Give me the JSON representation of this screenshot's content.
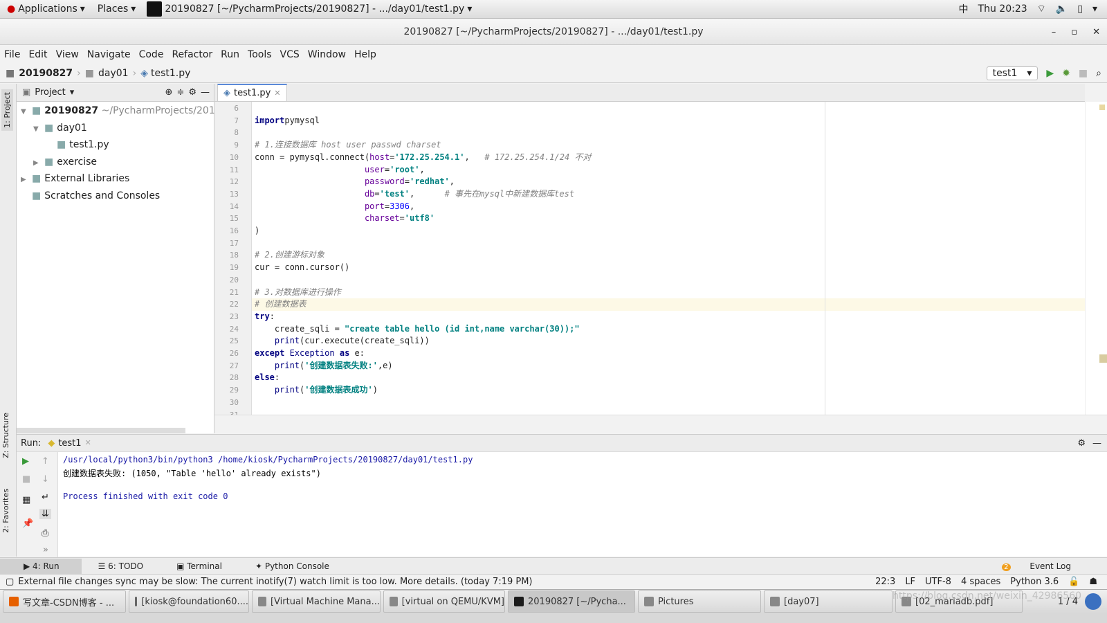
{
  "topbar": {
    "applications": "Applications",
    "places": "Places",
    "window_title": "20190827 [~/PycharmProjects/20190827] - .../day01/test1.py",
    "input_method": "中",
    "clock": "Thu 20:23"
  },
  "titlebar": {
    "title": "20190827 [~/PycharmProjects/20190827] - .../day01/test1.py"
  },
  "menu": [
    "File",
    "Edit",
    "View",
    "Navigate",
    "Code",
    "Refactor",
    "Run",
    "Tools",
    "VCS",
    "Window",
    "Help"
  ],
  "breadcrumb": [
    "20190827",
    "day01",
    "test1.py"
  ],
  "run_config": "test1",
  "side_tabs": {
    "project": "1: Project",
    "structure": "Z: Structure",
    "favorites": "2: Favorites"
  },
  "project": {
    "header": "Project",
    "tree": [
      {
        "label": "20190827",
        "extra": "~/PycharmProjects/2019",
        "level": 0,
        "arrow": "▼",
        "bold": true
      },
      {
        "label": "day01",
        "level": 1,
        "arrow": "▼"
      },
      {
        "label": "test1.py",
        "level": 2,
        "arrow": ""
      },
      {
        "label": "exercise",
        "level": 1,
        "arrow": "▶"
      },
      {
        "label": "External Libraries",
        "level": 0,
        "arrow": "▶"
      },
      {
        "label": "Scratches and Consoles",
        "level": 0,
        "arrow": ""
      }
    ]
  },
  "editor": {
    "tab": "test1.py",
    "cursor_line": 22,
    "lines": [
      {
        "n": "6",
        "t": []
      },
      {
        "n": "7",
        "t": [
          [
            "kw",
            "import"
          ],
          [
            "",
            "pymysql"
          ]
        ]
      },
      {
        "n": "8",
        "t": []
      },
      {
        "n": "9",
        "t": [
          [
            "cm",
            "# 1.连接数据库 host user passwd charset"
          ]
        ]
      },
      {
        "n": "10",
        "t": [
          [
            "",
            "conn = pymysql.connect("
          ],
          [
            "prm",
            "host"
          ],
          [
            "",
            "="
          ],
          [
            "str",
            "'172.25.254.1'"
          ],
          [
            "",
            ",   "
          ],
          [
            "cm",
            "# 172.25.254.1/24 不对"
          ]
        ]
      },
      {
        "n": "11",
        "t": [
          [
            "",
            "                      "
          ],
          [
            "prm",
            "user"
          ],
          [
            "",
            "="
          ],
          [
            "str",
            "'root'"
          ],
          [
            "",
            ","
          ]
        ]
      },
      {
        "n": "12",
        "t": [
          [
            "",
            "                      "
          ],
          [
            "prm",
            "password"
          ],
          [
            "",
            "="
          ],
          [
            "str",
            "'redhat'"
          ],
          [
            "",
            ","
          ]
        ]
      },
      {
        "n": "13",
        "t": [
          [
            "",
            "                      "
          ],
          [
            "prm",
            "db"
          ],
          [
            "",
            "="
          ],
          [
            "str",
            "'test'"
          ],
          [
            "",
            ",      "
          ],
          [
            "cm",
            "# 事先在mysql中新建数据库test"
          ]
        ]
      },
      {
        "n": "14",
        "t": [
          [
            "",
            "                      "
          ],
          [
            "prm",
            "port"
          ],
          [
            "",
            "="
          ],
          [
            "num",
            "3306"
          ],
          [
            "",
            ","
          ]
        ]
      },
      {
        "n": "15",
        "t": [
          [
            "",
            "                      "
          ],
          [
            "prm",
            "charset"
          ],
          [
            "",
            "="
          ],
          [
            "str",
            "'utf8'"
          ]
        ]
      },
      {
        "n": "16",
        "t": [
          [
            "",
            ")"
          ]
        ]
      },
      {
        "n": "17",
        "t": []
      },
      {
        "n": "18",
        "t": [
          [
            "cm",
            "# 2.创建游标对象"
          ]
        ]
      },
      {
        "n": "19",
        "t": [
          [
            "",
            "cur = conn.cursor()"
          ]
        ]
      },
      {
        "n": "20",
        "t": []
      },
      {
        "n": "21",
        "t": [
          [
            "cm",
            "# 3.对数据库进行操作"
          ]
        ]
      },
      {
        "n": "22",
        "t": [
          [
            "cm",
            "# 创建数据表"
          ]
        ]
      },
      {
        "n": "23",
        "t": [
          [
            "kw",
            "try"
          ],
          [
            "",
            ":"
          ]
        ]
      },
      {
        "n": "24",
        "t": [
          [
            "",
            "    create_sqli = "
          ],
          [
            "str",
            "\"create table hello (id int,name varchar(30));\""
          ]
        ]
      },
      {
        "n": "25",
        "t": [
          [
            "",
            "    "
          ],
          [
            "bi",
            "print"
          ],
          [
            "",
            "(cur.execute(create_sqli))"
          ]
        ]
      },
      {
        "n": "26",
        "t": [
          [
            "kw",
            "except"
          ],
          [
            "bi",
            " Exception "
          ],
          [
            "kw",
            "as"
          ],
          [
            "",
            " e:"
          ]
        ]
      },
      {
        "n": "27",
        "t": [
          [
            "",
            "    "
          ],
          [
            "bi",
            "print"
          ],
          [
            "",
            "("
          ],
          [
            "str",
            "'创建数据表失败:'"
          ],
          [
            "",
            ",e)"
          ]
        ]
      },
      {
        "n": "28",
        "t": [
          [
            "kw",
            "else"
          ],
          [
            "",
            ":"
          ]
        ]
      },
      {
        "n": "29",
        "t": [
          [
            "",
            "    "
          ],
          [
            "bi",
            "print"
          ],
          [
            "",
            "("
          ],
          [
            "str",
            "'创建数据表成功'"
          ],
          [
            "",
            ")"
          ]
        ]
      },
      {
        "n": "30",
        "t": []
      },
      {
        "n": "31",
        "t": []
      }
    ]
  },
  "run": {
    "label": "Run:",
    "tab": "test1",
    "output": [
      {
        "text": "/usr/local/python3/bin/python3 /home/kiosk/PycharmProjects/20190827/day01/test1.py",
        "color": "#1a1aa6"
      },
      {
        "text": "创建数据表失败: (1050, \"Table 'hello' already exists\")",
        "color": "#000000"
      },
      {
        "text": "",
        "color": "#000000"
      },
      {
        "text": "Process finished with exit code 0",
        "color": "#1a1aa6"
      }
    ]
  },
  "tool_tabs": [
    "4: Run",
    "6: TODO",
    "Terminal",
    "Python Console"
  ],
  "event_log": {
    "count": "2",
    "label": "Event Log"
  },
  "status": {
    "message": "External file changes sync may be slow: The current inotify(7) watch limit is too low. More details. (today 7:19 PM)",
    "position": "22:3",
    "line_sep": "LF",
    "encoding": "UTF-8",
    "indent": "4 spaces",
    "interpreter": "Python 3.6"
  },
  "taskbar": [
    {
      "label": "写文章-CSDN博客 - ...",
      "color": "#e66000"
    },
    {
      "label": "[kiosk@foundation60....",
      "color": "#666"
    },
    {
      "label": "[Virtual Machine Mana...",
      "color": "#888"
    },
    {
      "label": "[virtual on QEMU/KVM]",
      "color": "#888"
    },
    {
      "label": "20190827 [~/Pycha...",
      "color": "#1c1c1c",
      "active": true
    },
    {
      "label": "Pictures",
      "color": "#888"
    },
    {
      "label": "[day07]",
      "color": "#888"
    },
    {
      "label": "[02_mariadb.pdf]",
      "color": "#888"
    }
  ],
  "workspace": "1 / 4",
  "watermark": "https://blog.csdn.net/weixin_42986560"
}
